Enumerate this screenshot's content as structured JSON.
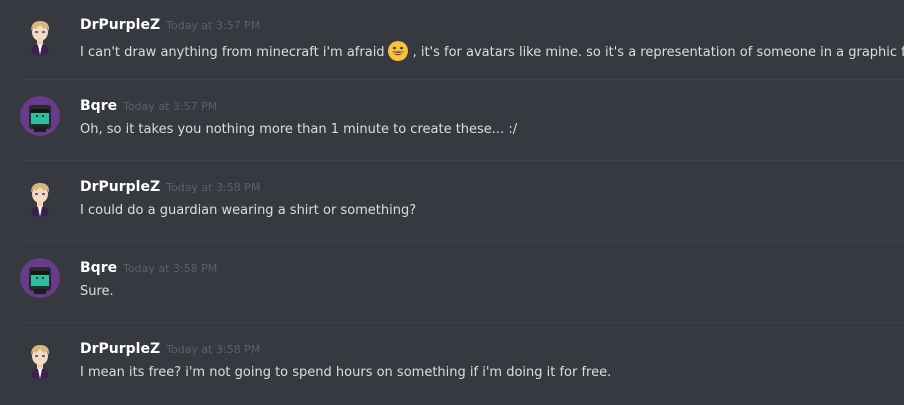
{
  "messages": [
    {
      "author": "DrPurpleZ",
      "time": "Today at 3:57 PM",
      "text_before": "I can't draw anything from minecraft i'm afraid",
      "emoji": "grinning-face-emoji",
      "text_after": ", it's for avatars like mine. so it's a representation of someone in a graphic form."
    },
    {
      "author": "Bqre",
      "time": "Today at 3:57 PM",
      "text": "Oh, so it takes you nothing more than 1 minute to create these... :/"
    },
    {
      "author": "DrPurpleZ",
      "time": "Today at 3:58 PM",
      "text": "I could do a guardian wearing a shirt or something?"
    },
    {
      "author": "Bqre",
      "time": "Today at 3:58 PM",
      "text": "Sure."
    },
    {
      "author": "DrPurpleZ",
      "time": "Today at 3:58 PM",
      "text": "I mean its free? i'm not going to spend hours on something if i'm doing it for free."
    }
  ],
  "colors": {
    "background": "#36393f",
    "username": "#ffffff",
    "timestamp": "#5d6068",
    "message_text": "#dcddde"
  }
}
